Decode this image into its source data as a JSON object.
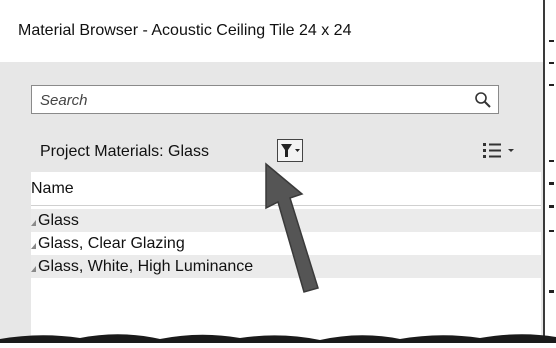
{
  "window": {
    "title": "Material Browser - Acoustic Ceiling Tile 24 x 24"
  },
  "search": {
    "placeholder": "Search"
  },
  "library": {
    "label": "Project Materials: Glass"
  },
  "list": {
    "column_header": "Name",
    "items": [
      {
        "label": "Glass"
      },
      {
        "label": "Glass, Clear Glazing"
      },
      {
        "label": "Glass, White, High Luminance"
      }
    ]
  },
  "icons": [
    "search-icon",
    "filter-icon",
    "chevron-down-icon",
    "list-view-icon",
    "pointer-arrow-icon"
  ],
  "colors": {
    "panel": "#e7e7e7",
    "row_alt": "#ebebeb",
    "arrow": "#555555"
  }
}
